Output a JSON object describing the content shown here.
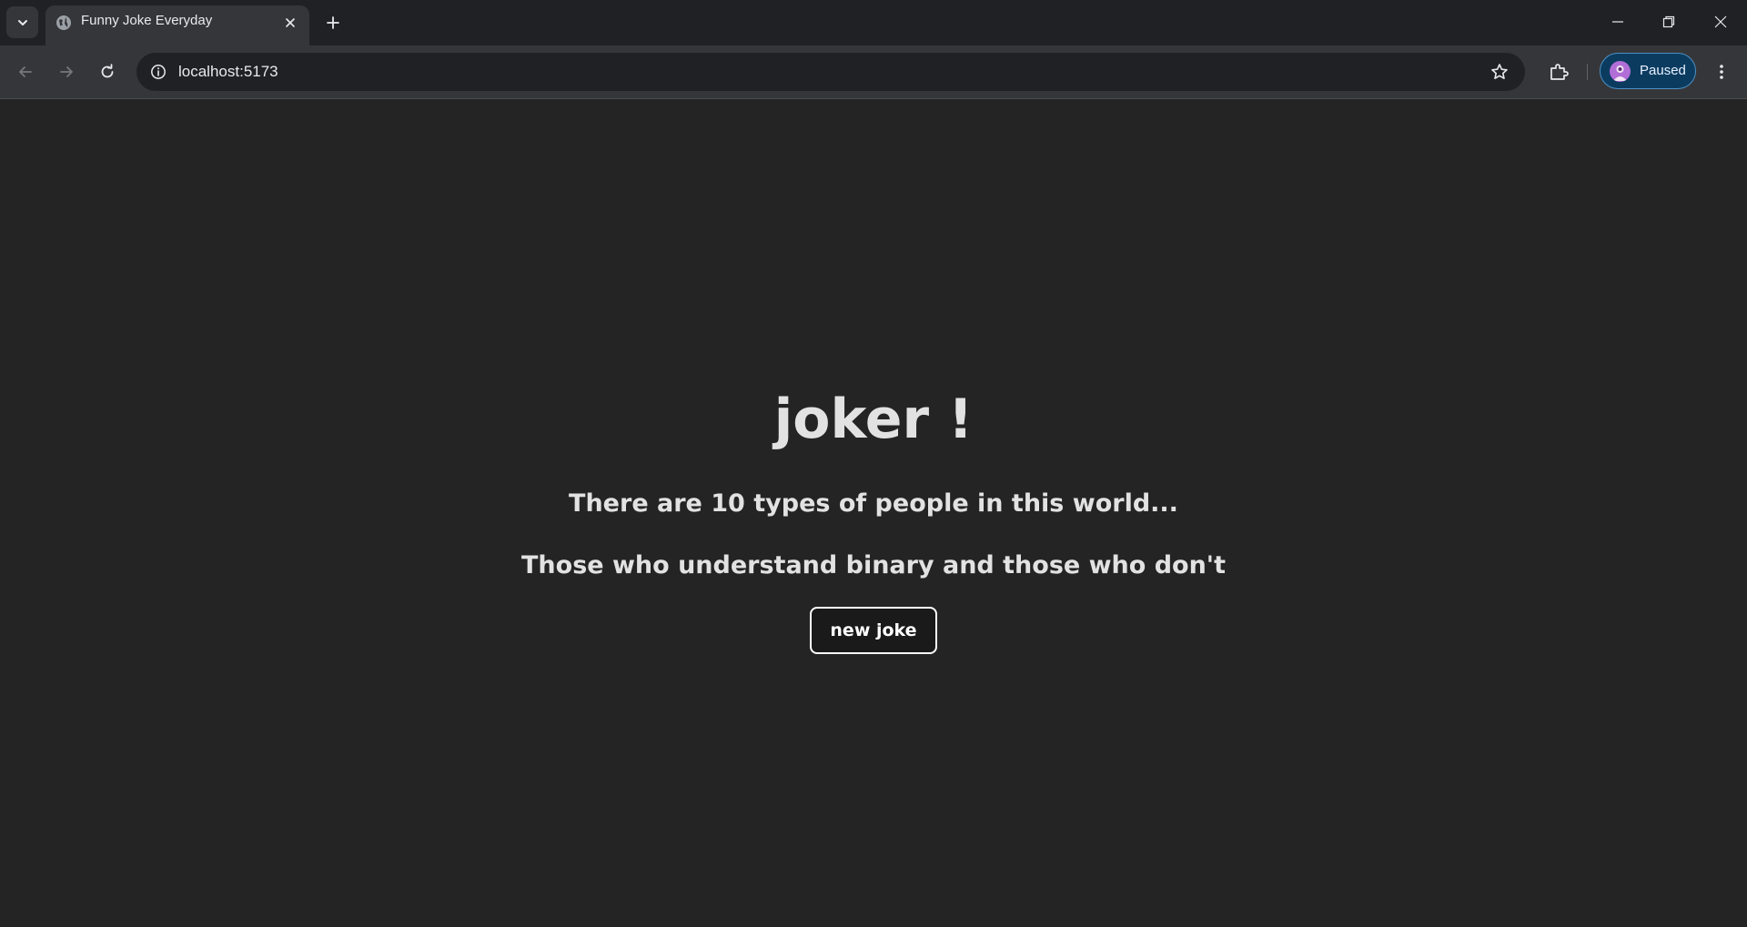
{
  "browser": {
    "tab": {
      "title": "Funny Joke Everyday",
      "favicon_icon": "globe-icon"
    },
    "address_bar": {
      "url": "localhost:5173"
    },
    "profile": {
      "label": "Paused"
    },
    "colors": {
      "chrome_bg": "#202124",
      "toolbar_bg": "#35363a",
      "profile_bg": "#0b3c60",
      "avatar": "#b06ed6"
    }
  },
  "page": {
    "title": "joker !",
    "joke": {
      "setup": "There are 10 types of people in this world...",
      "punchline": "Those who understand binary and those who don't"
    },
    "button_label": "new joke",
    "colors": {
      "background": "#242424",
      "text": "#dedede",
      "button_border": "#ffffff"
    }
  }
}
